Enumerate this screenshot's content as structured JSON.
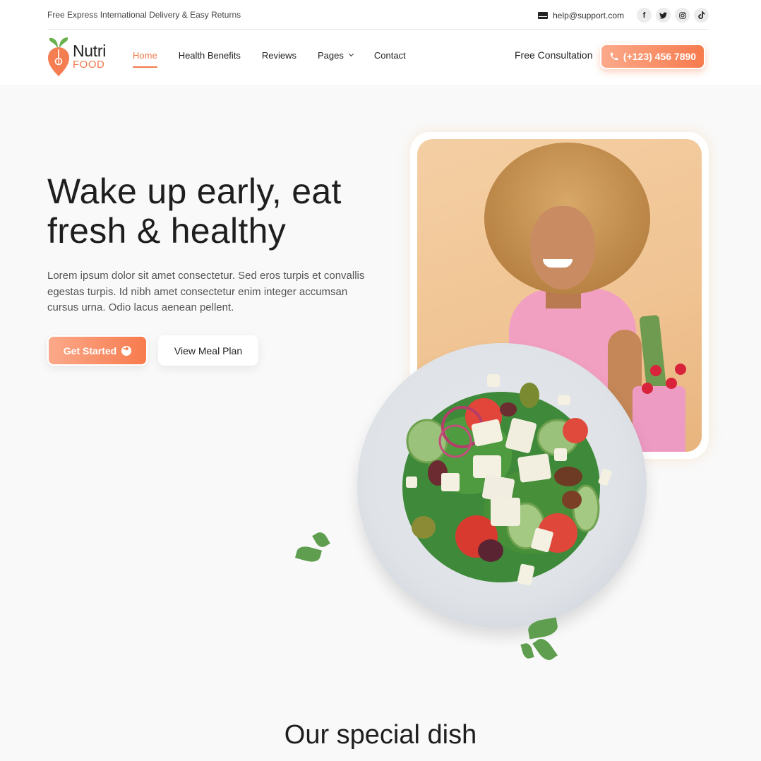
{
  "topbar": {
    "announcement": "Free Express International Delivery & Easy Returns",
    "email": "help@support.com",
    "email_icon": "mail-icon",
    "socials": [
      {
        "name": "facebook",
        "glyph": "f"
      },
      {
        "name": "twitter",
        "glyph": "🐦"
      },
      {
        "name": "instagram",
        "glyph": "◎"
      },
      {
        "name": "tiktok",
        "glyph": "♪"
      }
    ]
  },
  "logo": {
    "primary": "Nutri",
    "secondary": "FOOD",
    "icon": "carrot-leaf-icon"
  },
  "nav": {
    "items": [
      {
        "label": "Home",
        "active": true
      },
      {
        "label": "Health Benefits"
      },
      {
        "label": "Reviews"
      },
      {
        "label": "Pages",
        "has_dropdown": true
      },
      {
        "label": "Contact"
      }
    ],
    "consultation_label": "Free Consultation",
    "phone": "(+123) 456 7890"
  },
  "hero": {
    "title_line1": "Wake up early, eat",
    "title_line2": "fresh & healthy",
    "description": "Lorem ipsum dolor sit amet consectetur. Sed eros turpis et convallis egestas turpis. Id nibh amet consectetur enim integer accumsan cursus urna. Odio lacus aenean pellent.",
    "primary_button": "Get Started",
    "secondary_button": "View Meal Plan"
  },
  "section": {
    "title": "Our special dish"
  },
  "colors": {
    "accent": "#f77b4d",
    "accent_light": "#fba98a",
    "logo_green": "#6ab04c",
    "text_dark": "#1e1e1e"
  }
}
